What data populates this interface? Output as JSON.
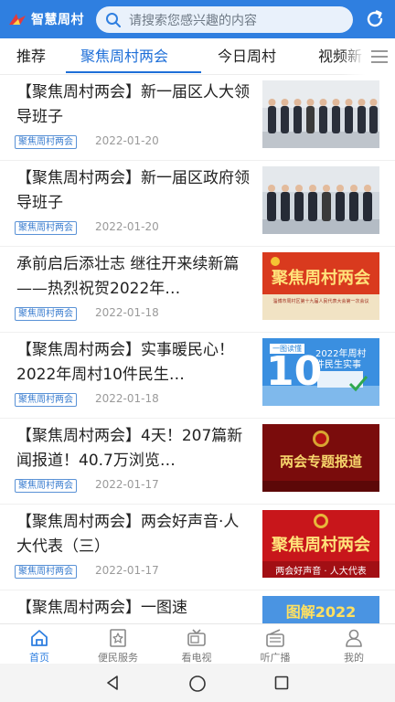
{
  "header": {
    "logo_text": "智慧周村",
    "search_placeholder": "请搜索您感兴趣的内容",
    "accent_color": "#2f7fe0"
  },
  "tabs": [
    {
      "label": "推荐",
      "active": false
    },
    {
      "label": "聚焦周村两会",
      "active": true
    },
    {
      "label": "今日周村",
      "active": false
    },
    {
      "label": "视频新",
      "active": false
    }
  ],
  "articles": [
    {
      "title": "【聚焦周村两会】新一届区人大领导班子",
      "tag": "聚焦周村两会",
      "date": "2022-01-20",
      "thumb": "group-photo"
    },
    {
      "title": "【聚焦周村两会】新一届区政府领导班子",
      "tag": "聚焦周村两会",
      "date": "2022-01-20",
      "thumb": "group-photo"
    },
    {
      "title": "承前启后添壮志 继往开来续新篇 ——热烈祝贺2022年…",
      "tag": "聚焦周村两会",
      "date": "2022-01-18",
      "thumb": "banner-red",
      "thumb_text": "聚焦周村两会",
      "thumb_caption": "淄博市周村区第十九届人民代表大会第一次会议"
    },
    {
      "title": "【聚焦周村两会】实事暖民心！2022年周村10件民生…",
      "tag": "聚焦周村两会",
      "date": "2022-01-18",
      "thumb": "banner-blue",
      "thumb_text": "10",
      "thumb_badge": "一图读懂",
      "thumb_caption": "2022年周村 件民生实事"
    },
    {
      "title": "【聚焦周村两会】4天！207篇新闻报道！40.7万浏览…",
      "tag": "聚焦周村两会",
      "date": "2022-01-17",
      "thumb": "banner-dark",
      "thumb_text": "两会专题报道"
    },
    {
      "title": "【聚焦周村两会】两会好声音·人大代表（三）",
      "tag": "聚焦周村两会",
      "date": "2022-01-17",
      "thumb": "banner-red2",
      "thumb_text": "聚焦周村两会",
      "thumb_caption": "两会好声音 · 人大代表"
    },
    {
      "title": "【聚焦周村两会】一图速",
      "tag": "",
      "date": "",
      "thumb": "banner-blue2",
      "thumb_text": "图解2022"
    }
  ],
  "bottom_nav": [
    {
      "label": "首页",
      "icon": "home-icon",
      "active": true
    },
    {
      "label": "便民服务",
      "icon": "star-badge-icon",
      "active": false
    },
    {
      "label": "看电视",
      "icon": "tv-icon",
      "active": false
    },
    {
      "label": "听广播",
      "icon": "radio-icon",
      "active": false
    },
    {
      "label": "我的",
      "icon": "user-icon",
      "active": false
    }
  ]
}
